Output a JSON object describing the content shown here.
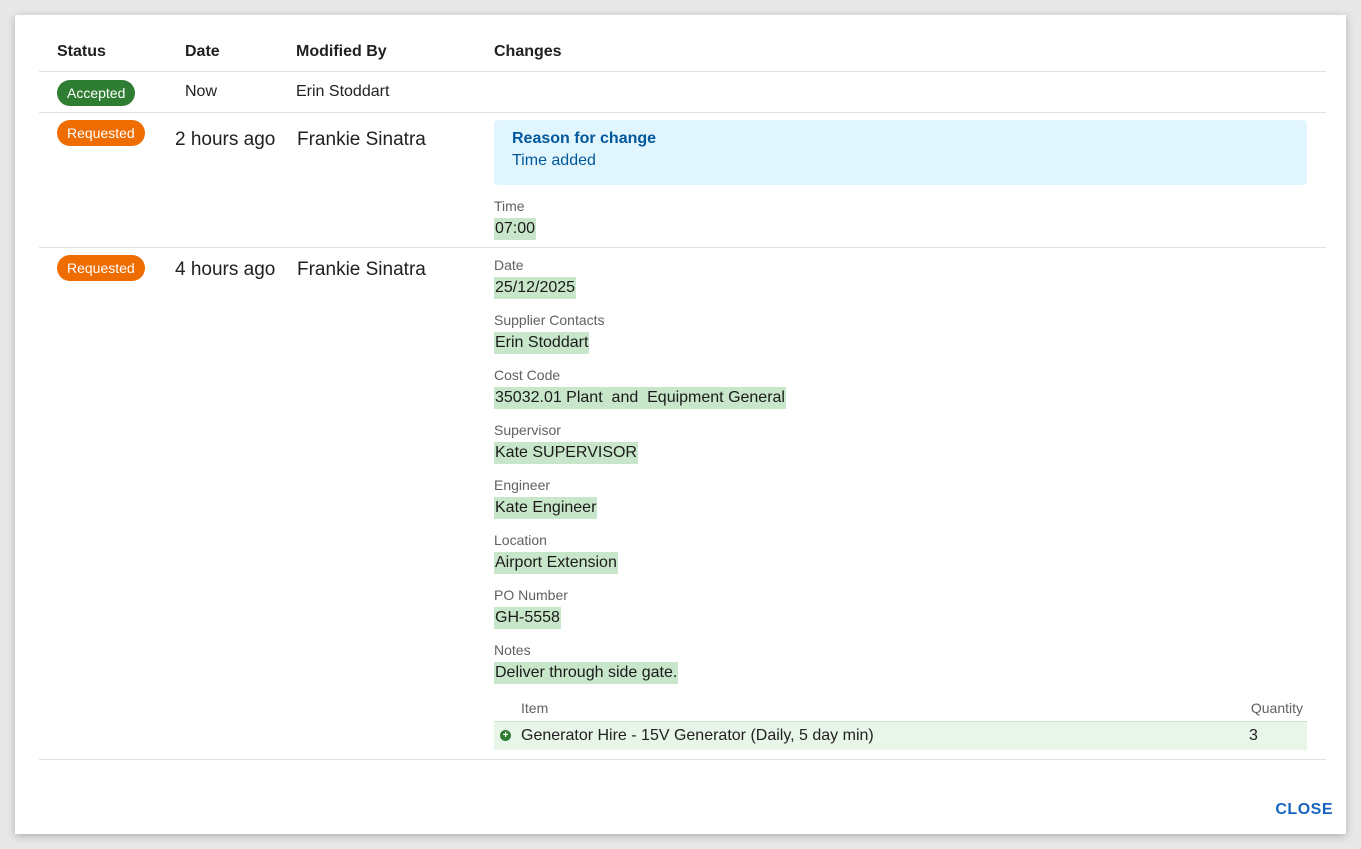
{
  "columns": {
    "status": "Status",
    "date": "Date",
    "modified_by": "Modified By",
    "changes": "Changes"
  },
  "rows": [
    {
      "status": "Accepted",
      "date": "Now",
      "modified_by": "Erin Stoddart"
    },
    {
      "status": "Requested",
      "date": "2 hours ago",
      "modified_by": "Frankie Sinatra",
      "reason_title": "Reason for change",
      "reason_text": "Time added",
      "fields": [
        {
          "label": "Time",
          "value": "07:00"
        }
      ]
    },
    {
      "status": "Requested",
      "date": "4 hours ago",
      "modified_by": "Frankie Sinatra",
      "fields": [
        {
          "label": "Date",
          "value": "25/12/2025"
        },
        {
          "label": "Supplier Contacts",
          "value": "Erin Stoddart"
        },
        {
          "label": "Cost Code",
          "value": "35032.01 Plant  and  Equipment General"
        },
        {
          "label": "Supervisor",
          "value": "Kate SUPERVISOR"
        },
        {
          "label": "Engineer",
          "value": "Kate Engineer"
        },
        {
          "label": "Location",
          "value": "Airport Extension"
        },
        {
          "label": "PO Number",
          "value": "GH-5558"
        },
        {
          "label": "Notes",
          "value": "Deliver through side gate."
        }
      ],
      "items_header": {
        "item": "Item",
        "quantity": "Quantity"
      },
      "items": [
        {
          "name": "Generator Hire - 15V Generator (Daily, 5 day min)",
          "quantity": "3",
          "icon": "plus-circle-icon"
        }
      ]
    }
  ],
  "close_label": "CLOSE",
  "colors": {
    "accepted": "#2e7d32",
    "requested": "#ef6c00",
    "added_highlight": "#c8e6c9",
    "reason_bg": "#e1f5fe",
    "link": "#1565c0"
  }
}
